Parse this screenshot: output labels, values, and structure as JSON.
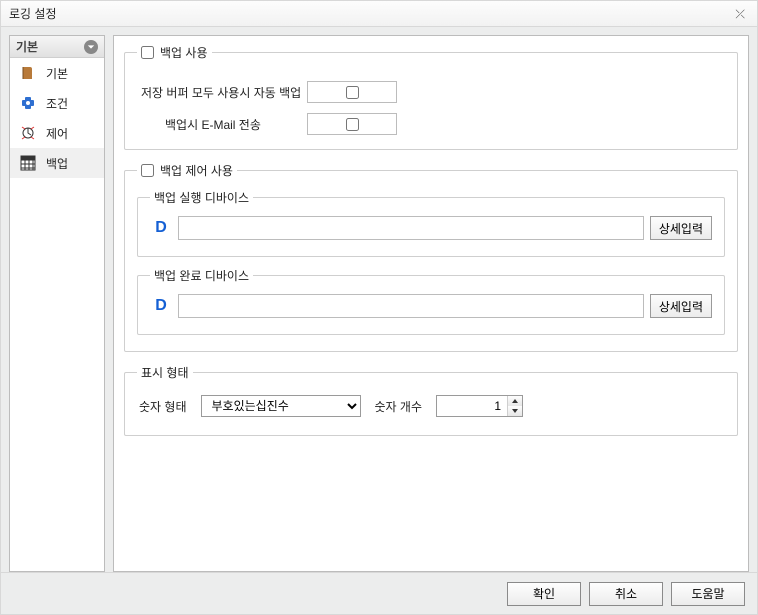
{
  "window": {
    "title": "로깅 설정"
  },
  "sidebar": {
    "header": "기본",
    "items": [
      {
        "label": "기본"
      },
      {
        "label": "조건"
      },
      {
        "label": "제어"
      },
      {
        "label": "백업"
      }
    ],
    "selected_index": 3
  },
  "backup_use": {
    "legend": "백업 사용",
    "checked": false,
    "rows": [
      {
        "label": "저장 버퍼 모두 사용시 자동 백업",
        "checked": false
      },
      {
        "label": "백업시 E-Mail 전송",
        "checked": false
      }
    ]
  },
  "backup_ctrl": {
    "legend": "백업 제어 사용",
    "checked": false,
    "exec": {
      "label": "백업 실행 디바이스",
      "badge": "D",
      "value": "",
      "detail_btn": "상세입력"
    },
    "done": {
      "label": "백업 완료 디바이스",
      "badge": "D",
      "value": "",
      "detail_btn": "상세입력"
    }
  },
  "display_fmt": {
    "legend": "표시 형태",
    "num_type_label": "숫자 형태",
    "num_type_value": "부호있는십진수",
    "num_count_label": "숫자 개수",
    "num_count_value": "1"
  },
  "footer": {
    "ok": "확인",
    "cancel": "취소",
    "help": "도움말"
  }
}
